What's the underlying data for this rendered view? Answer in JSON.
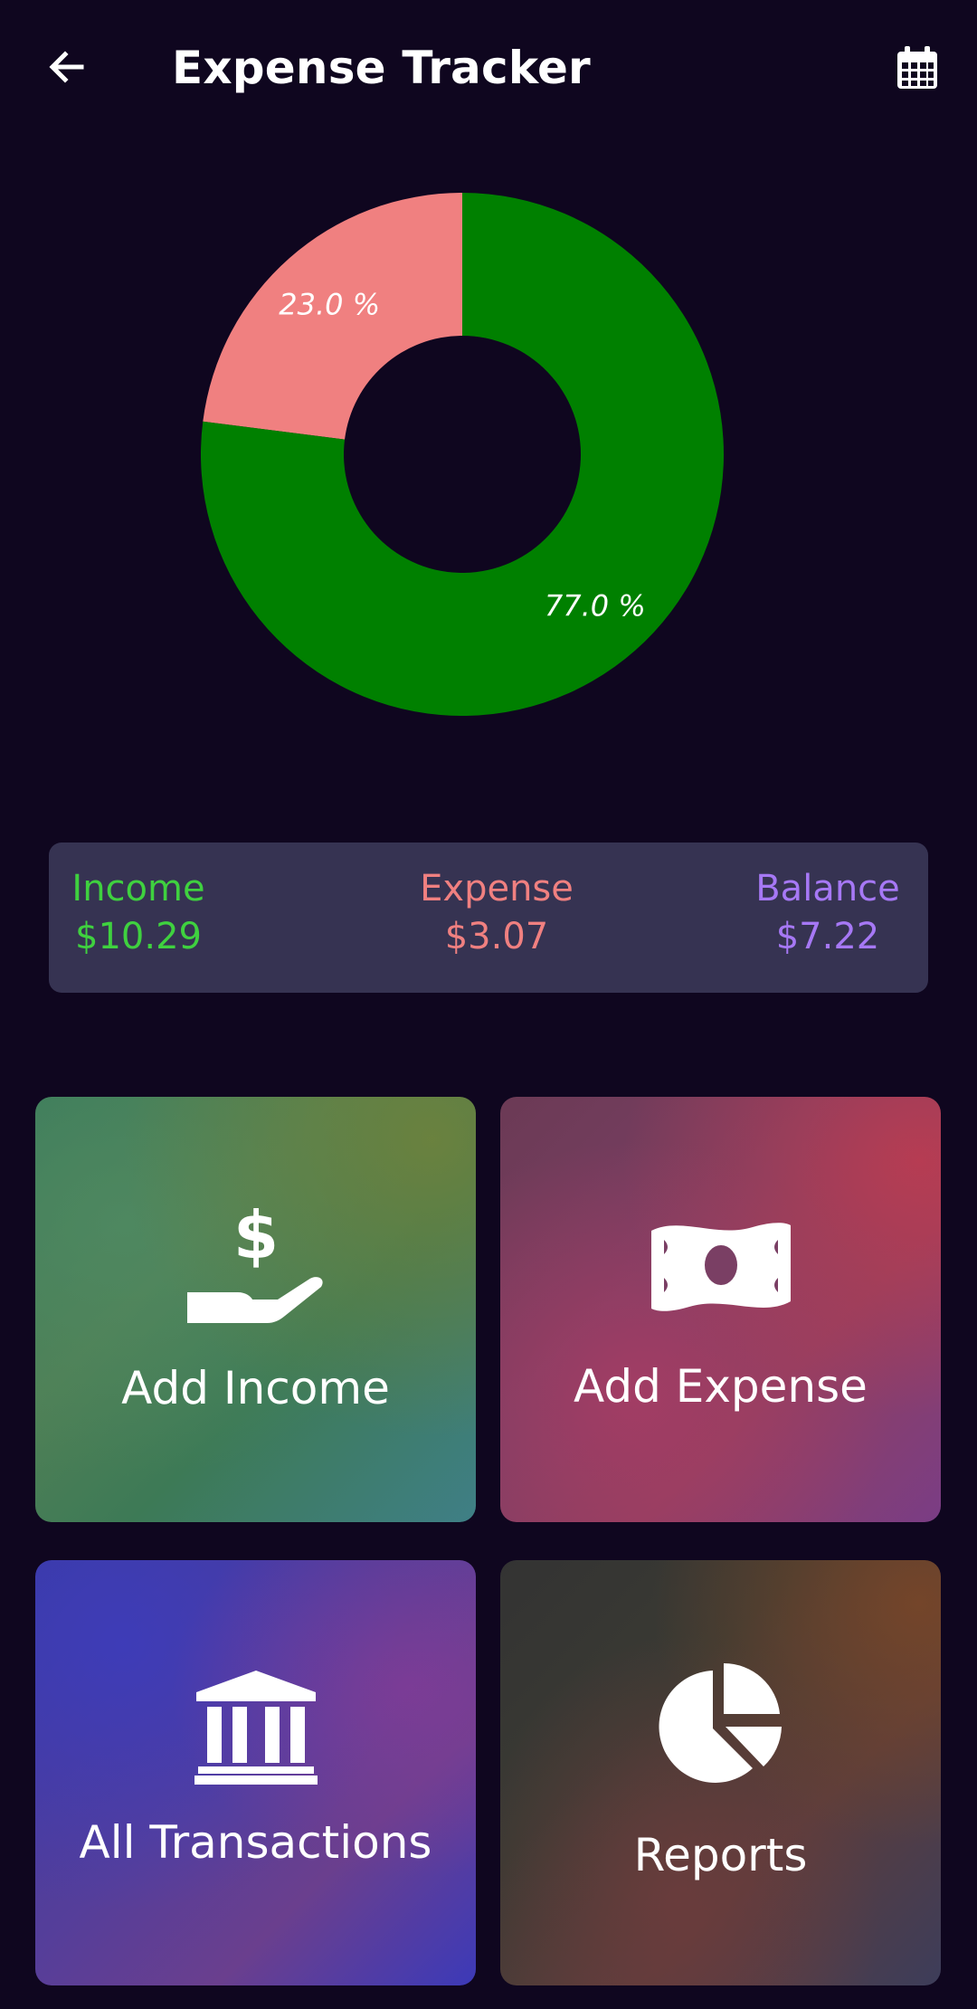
{
  "app_bar": {
    "title": "Expense Tracker",
    "back_icon": "arrow-left-icon",
    "calendar_icon": "calendar-icon"
  },
  "chart_data": {
    "type": "pie",
    "donut": true,
    "slices": [
      {
        "label": "23.0 %",
        "value": 23.0,
        "color": "#f08080"
      },
      {
        "label": "77.0 %",
        "value": 77.0,
        "color": "#008000"
      }
    ]
  },
  "summary": {
    "income": {
      "label": "Income",
      "value": "$10.29",
      "color": "#3fd13f"
    },
    "expense": {
      "label": "Expense",
      "value": "$3.07",
      "color": "#f08080"
    },
    "balance": {
      "label": "Balance",
      "value": "$7.22",
      "color": "#a678f5"
    }
  },
  "tiles": [
    {
      "label": "Add Income",
      "icon": "hand-holding-dollar-icon"
    },
    {
      "label": "Add Expense",
      "icon": "money-bill-icon"
    },
    {
      "label": "All Transactions",
      "icon": "bank-icon"
    },
    {
      "label": "Reports",
      "icon": "pie-chart-icon"
    }
  ]
}
